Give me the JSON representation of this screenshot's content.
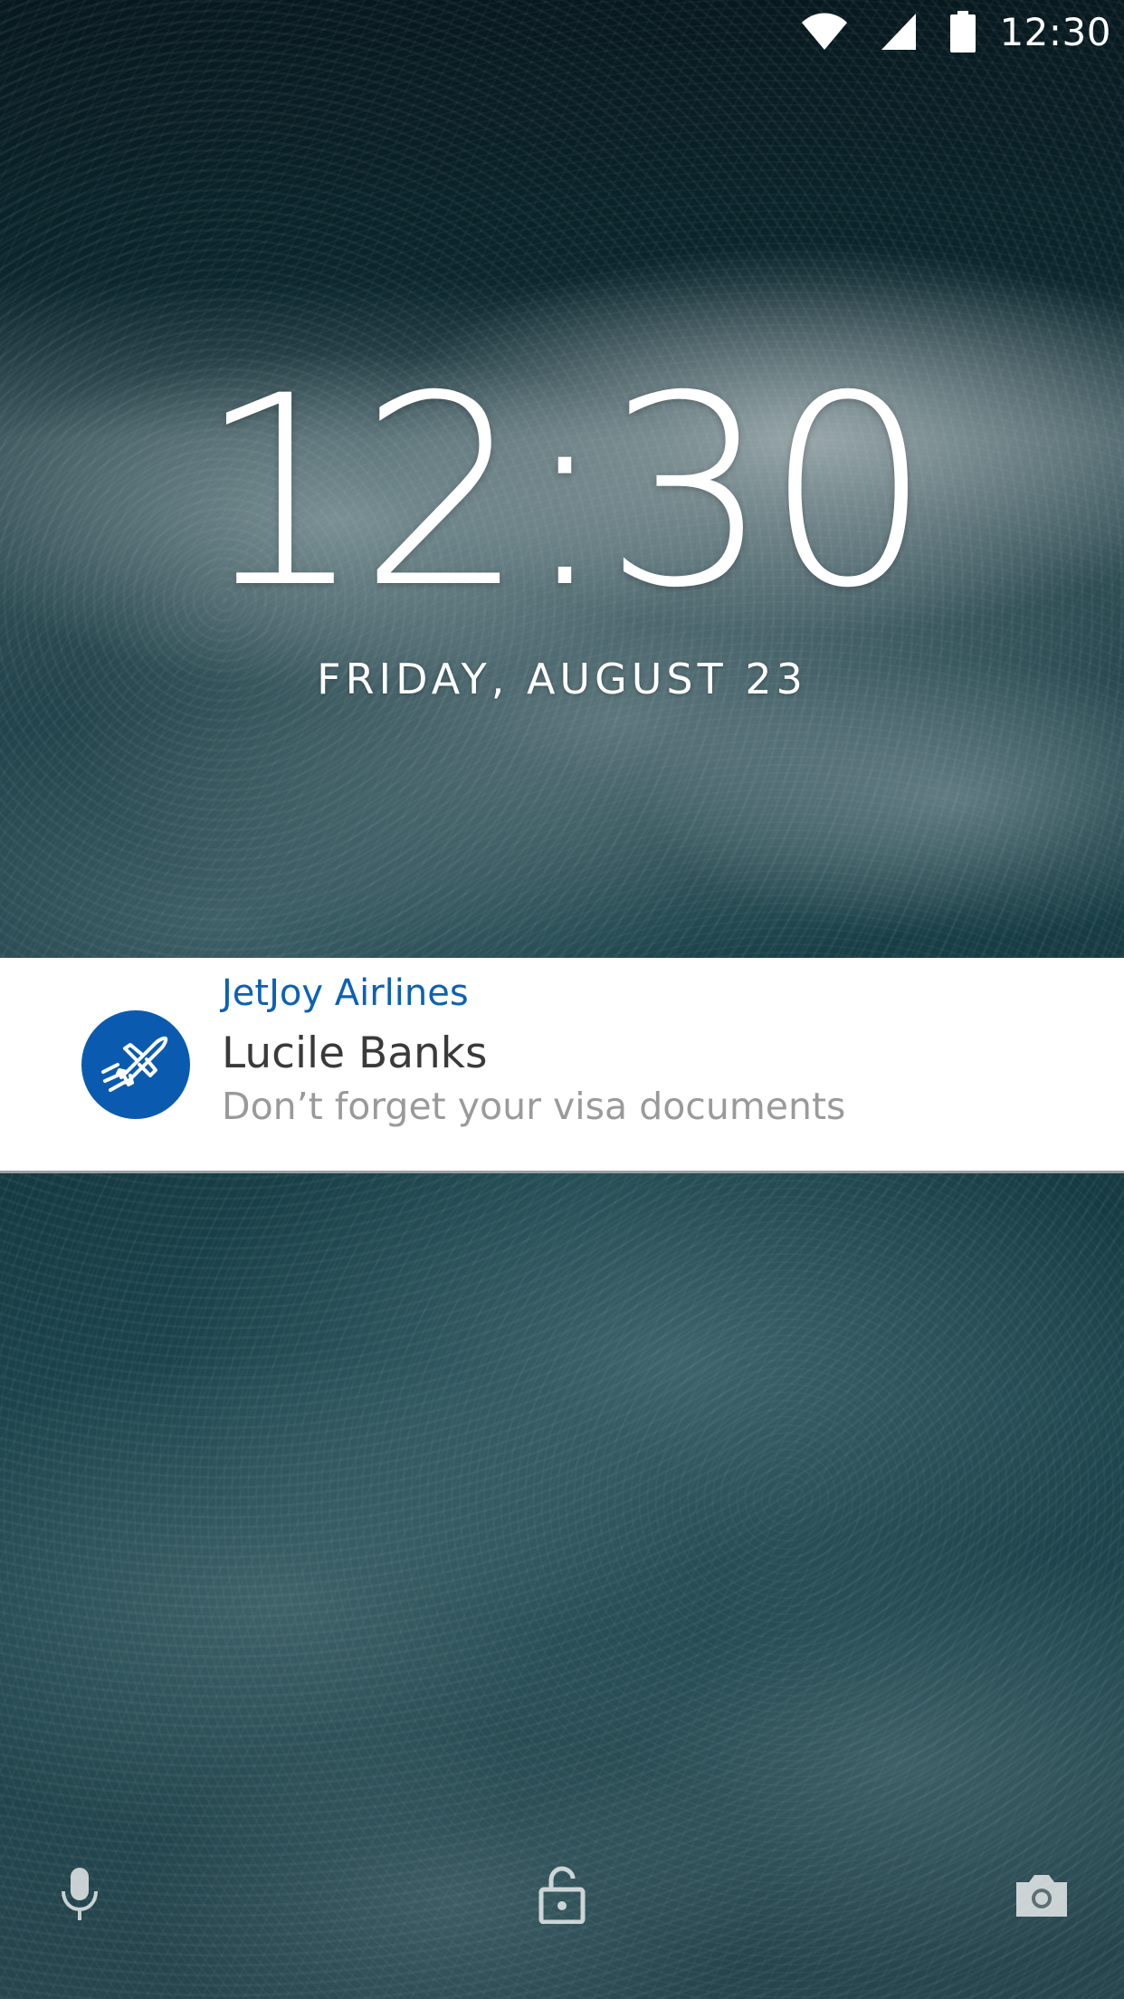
{
  "status_bar": {
    "time": "12:30",
    "icons": [
      "wifi-icon",
      "cell-signal-icon",
      "battery-icon"
    ]
  },
  "lock_screen": {
    "clock": "12:30",
    "date": "FRIDAY, AUGUST 23"
  },
  "notification": {
    "app_icon": "airplane-icon",
    "app_name": "JetJoy Airlines",
    "title": "Lucile Banks",
    "body": "Don’t forget your visa documents",
    "colors": {
      "accent": "#0d61b5",
      "avatar_bg": "#0a5bb0"
    }
  },
  "bottom_actions": [
    {
      "icon": "microphone-icon"
    },
    {
      "icon": "unlock-icon"
    },
    {
      "icon": "camera-icon"
    }
  ]
}
